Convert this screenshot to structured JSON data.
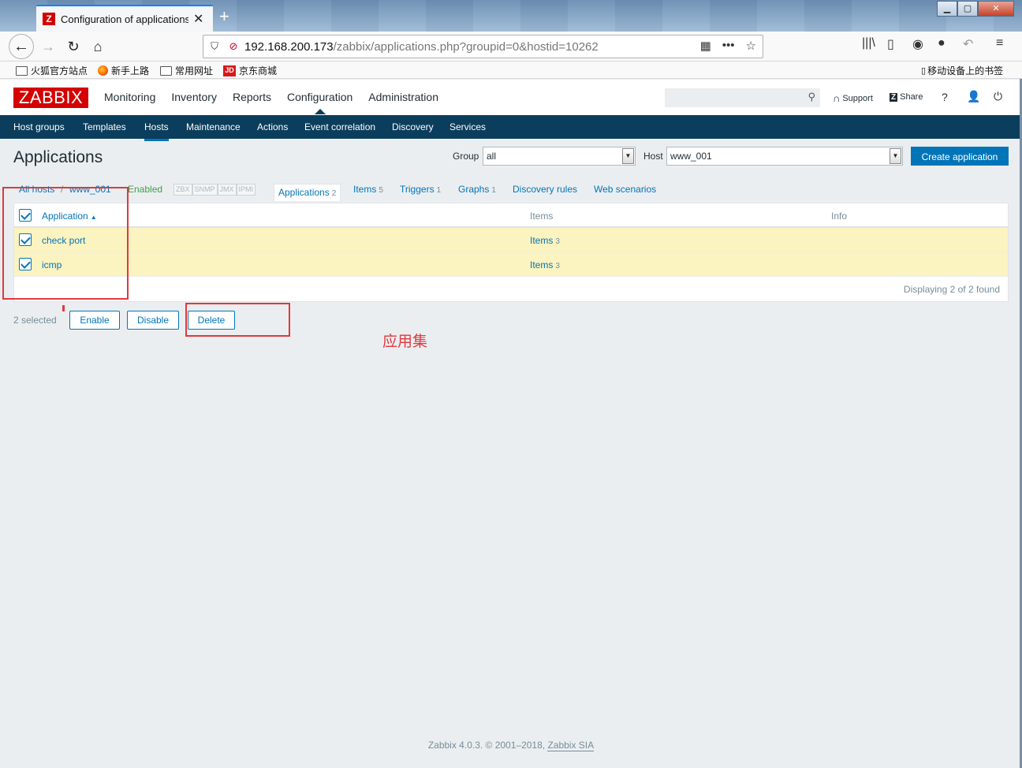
{
  "browser": {
    "tab_favicon": "Z",
    "tab_title": "Configuration of applications",
    "tab_close": "✕",
    "new_tab": "+",
    "url_host": "192.168.200.173",
    "url_path": "/zabbix/applications.php?groupid=0&hostid=10262",
    "bookmarks": [
      {
        "label": "火狐官方站点",
        "icon": "folder-icon"
      },
      {
        "label": "新手上路",
        "icon": "firefox-icon"
      },
      {
        "label": "常用网址",
        "icon": "folder-icon"
      },
      {
        "label": "京东商城",
        "icon": "jd-icon"
      }
    ],
    "jd_icon_text": "JD",
    "mobile_bookmarks": "移动设备上的书签"
  },
  "header": {
    "logo": "ZABBIX",
    "menu": [
      "Monitoring",
      "Inventory",
      "Reports",
      "Configuration",
      "Administration"
    ],
    "active_menu": "Configuration",
    "search_placeholder": "",
    "support": "Support",
    "share": "Share",
    "share_icon": "Z",
    "help": "?"
  },
  "subnav": {
    "items": [
      "Host groups",
      "Templates",
      "Hosts",
      "Maintenance",
      "Actions",
      "Event correlation",
      "Discovery",
      "Services"
    ],
    "selected": "Hosts"
  },
  "page": {
    "title": "Applications",
    "group_label": "Group",
    "group_value": "all",
    "host_label": "Host",
    "host_value": "www_001",
    "create_button": "Create application"
  },
  "host_nav": {
    "all_hosts": "All hosts",
    "separator": "/",
    "host": "www_001",
    "status": "Enabled",
    "availability": [
      "ZBX",
      "SNMP",
      "JMX",
      "IPMI"
    ],
    "tabs": [
      {
        "label": "Applications",
        "count": "2"
      },
      {
        "label": "Items",
        "count": "5"
      },
      {
        "label": "Triggers",
        "count": "1"
      },
      {
        "label": "Graphs",
        "count": "1"
      },
      {
        "label": "Discovery rules",
        "count": ""
      },
      {
        "label": "Web scenarios",
        "count": ""
      }
    ]
  },
  "table": {
    "columns": [
      "Application",
      "Items",
      "Info"
    ],
    "rows": [
      {
        "application": "check port",
        "items_label": "Items",
        "items_count": "3",
        "checked": true
      },
      {
        "application": "icmp",
        "items_label": "Items",
        "items_count": "3",
        "checked": true
      }
    ],
    "footer": "Displaying 2 of 2 found"
  },
  "actions": {
    "selected": "2 selected",
    "enable": "Enable",
    "disable": "Disable",
    "delete": "Delete"
  },
  "annotation": "应用集",
  "footer": {
    "text": "Zabbix 4.0.3. © 2001–2018, ",
    "link": "Zabbix SIA"
  },
  "colors": {
    "brand_red": "#d40000",
    "nav_dark": "#0b3e5c",
    "link_blue": "#0275b8",
    "selected_row": "#fbf3c0",
    "annotation_red": "#e0393e"
  }
}
